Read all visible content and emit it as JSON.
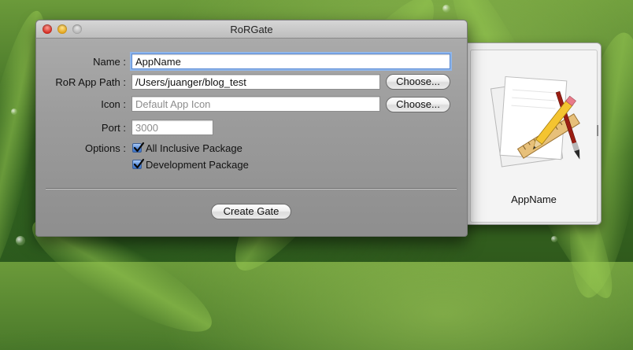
{
  "window": {
    "title": "RoRGate"
  },
  "form": {
    "name_label": "Name :",
    "name_value": "AppName",
    "path_label": "RoR App Path :",
    "path_value": "/Users/juanger/blog_test",
    "icon_label": "Icon :",
    "icon_placeholder": "Default App Icon",
    "port_label": "Port :",
    "port_placeholder": "3000",
    "options_label": "Options :",
    "choose_label": "Choose...",
    "choose_icon_label": "Choose...",
    "option_all_inclusive": "All Inclusive Package",
    "option_all_inclusive_checked": true,
    "option_development": "Development Package",
    "option_development_checked": true,
    "create_label": "Create Gate"
  },
  "drawer": {
    "app_name": "AppName",
    "icon": "app-document-pencil-ruler-icon"
  },
  "colors": {
    "focus_ring": "#8fb6ea",
    "checkbox_blue": "#4f86d8",
    "close": "#d2281d",
    "minimize": "#e3a318",
    "zoom": "#b4b4b4"
  }
}
